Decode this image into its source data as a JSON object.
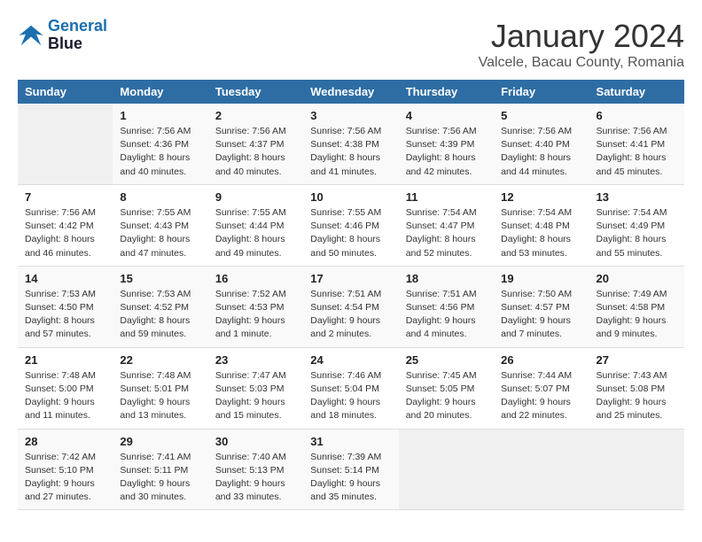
{
  "logo": {
    "line1": "General",
    "line2": "Blue"
  },
  "title": "January 2024",
  "location": "Valcele, Bacau County, Romania",
  "days_header": [
    "Sunday",
    "Monday",
    "Tuesday",
    "Wednesday",
    "Thursday",
    "Friday",
    "Saturday"
  ],
  "weeks": [
    [
      {
        "date": "",
        "sunrise": "",
        "sunset": "",
        "daylight": ""
      },
      {
        "date": "1",
        "sunrise": "Sunrise: 7:56 AM",
        "sunset": "Sunset: 4:36 PM",
        "daylight": "Daylight: 8 hours and 40 minutes."
      },
      {
        "date": "2",
        "sunrise": "Sunrise: 7:56 AM",
        "sunset": "Sunset: 4:37 PM",
        "daylight": "Daylight: 8 hours and 40 minutes."
      },
      {
        "date": "3",
        "sunrise": "Sunrise: 7:56 AM",
        "sunset": "Sunset: 4:38 PM",
        "daylight": "Daylight: 8 hours and 41 minutes."
      },
      {
        "date": "4",
        "sunrise": "Sunrise: 7:56 AM",
        "sunset": "Sunset: 4:39 PM",
        "daylight": "Daylight: 8 hours and 42 minutes."
      },
      {
        "date": "5",
        "sunrise": "Sunrise: 7:56 AM",
        "sunset": "Sunset: 4:40 PM",
        "daylight": "Daylight: 8 hours and 44 minutes."
      },
      {
        "date": "6",
        "sunrise": "Sunrise: 7:56 AM",
        "sunset": "Sunset: 4:41 PM",
        "daylight": "Daylight: 8 hours and 45 minutes."
      }
    ],
    [
      {
        "date": "7",
        "sunrise": "Sunrise: 7:56 AM",
        "sunset": "Sunset: 4:42 PM",
        "daylight": "Daylight: 8 hours and 46 minutes."
      },
      {
        "date": "8",
        "sunrise": "Sunrise: 7:55 AM",
        "sunset": "Sunset: 4:43 PM",
        "daylight": "Daylight: 8 hours and 47 minutes."
      },
      {
        "date": "9",
        "sunrise": "Sunrise: 7:55 AM",
        "sunset": "Sunset: 4:44 PM",
        "daylight": "Daylight: 8 hours and 49 minutes."
      },
      {
        "date": "10",
        "sunrise": "Sunrise: 7:55 AM",
        "sunset": "Sunset: 4:46 PM",
        "daylight": "Daylight: 8 hours and 50 minutes."
      },
      {
        "date": "11",
        "sunrise": "Sunrise: 7:54 AM",
        "sunset": "Sunset: 4:47 PM",
        "daylight": "Daylight: 8 hours and 52 minutes."
      },
      {
        "date": "12",
        "sunrise": "Sunrise: 7:54 AM",
        "sunset": "Sunset: 4:48 PM",
        "daylight": "Daylight: 8 hours and 53 minutes."
      },
      {
        "date": "13",
        "sunrise": "Sunrise: 7:54 AM",
        "sunset": "Sunset: 4:49 PM",
        "daylight": "Daylight: 8 hours and 55 minutes."
      }
    ],
    [
      {
        "date": "14",
        "sunrise": "Sunrise: 7:53 AM",
        "sunset": "Sunset: 4:50 PM",
        "daylight": "Daylight: 8 hours and 57 minutes."
      },
      {
        "date": "15",
        "sunrise": "Sunrise: 7:53 AM",
        "sunset": "Sunset: 4:52 PM",
        "daylight": "Daylight: 8 hours and 59 minutes."
      },
      {
        "date": "16",
        "sunrise": "Sunrise: 7:52 AM",
        "sunset": "Sunset: 4:53 PM",
        "daylight": "Daylight: 9 hours and 1 minute."
      },
      {
        "date": "17",
        "sunrise": "Sunrise: 7:51 AM",
        "sunset": "Sunset: 4:54 PM",
        "daylight": "Daylight: 9 hours and 2 minutes."
      },
      {
        "date": "18",
        "sunrise": "Sunrise: 7:51 AM",
        "sunset": "Sunset: 4:56 PM",
        "daylight": "Daylight: 9 hours and 4 minutes."
      },
      {
        "date": "19",
        "sunrise": "Sunrise: 7:50 AM",
        "sunset": "Sunset: 4:57 PM",
        "daylight": "Daylight: 9 hours and 7 minutes."
      },
      {
        "date": "20",
        "sunrise": "Sunrise: 7:49 AM",
        "sunset": "Sunset: 4:58 PM",
        "daylight": "Daylight: 9 hours and 9 minutes."
      }
    ],
    [
      {
        "date": "21",
        "sunrise": "Sunrise: 7:48 AM",
        "sunset": "Sunset: 5:00 PM",
        "daylight": "Daylight: 9 hours and 11 minutes."
      },
      {
        "date": "22",
        "sunrise": "Sunrise: 7:48 AM",
        "sunset": "Sunset: 5:01 PM",
        "daylight": "Daylight: 9 hours and 13 minutes."
      },
      {
        "date": "23",
        "sunrise": "Sunrise: 7:47 AM",
        "sunset": "Sunset: 5:03 PM",
        "daylight": "Daylight: 9 hours and 15 minutes."
      },
      {
        "date": "24",
        "sunrise": "Sunrise: 7:46 AM",
        "sunset": "Sunset: 5:04 PM",
        "daylight": "Daylight: 9 hours and 18 minutes."
      },
      {
        "date": "25",
        "sunrise": "Sunrise: 7:45 AM",
        "sunset": "Sunset: 5:05 PM",
        "daylight": "Daylight: 9 hours and 20 minutes."
      },
      {
        "date": "26",
        "sunrise": "Sunrise: 7:44 AM",
        "sunset": "Sunset: 5:07 PM",
        "daylight": "Daylight: 9 hours and 22 minutes."
      },
      {
        "date": "27",
        "sunrise": "Sunrise: 7:43 AM",
        "sunset": "Sunset: 5:08 PM",
        "daylight": "Daylight: 9 hours and 25 minutes."
      }
    ],
    [
      {
        "date": "28",
        "sunrise": "Sunrise: 7:42 AM",
        "sunset": "Sunset: 5:10 PM",
        "daylight": "Daylight: 9 hours and 27 minutes."
      },
      {
        "date": "29",
        "sunrise": "Sunrise: 7:41 AM",
        "sunset": "Sunset: 5:11 PM",
        "daylight": "Daylight: 9 hours and 30 minutes."
      },
      {
        "date": "30",
        "sunrise": "Sunrise: 7:40 AM",
        "sunset": "Sunset: 5:13 PM",
        "daylight": "Daylight: 9 hours and 33 minutes."
      },
      {
        "date": "31",
        "sunrise": "Sunrise: 7:39 AM",
        "sunset": "Sunset: 5:14 PM",
        "daylight": "Daylight: 9 hours and 35 minutes."
      },
      {
        "date": "",
        "sunrise": "",
        "sunset": "",
        "daylight": ""
      },
      {
        "date": "",
        "sunrise": "",
        "sunset": "",
        "daylight": ""
      },
      {
        "date": "",
        "sunrise": "",
        "sunset": "",
        "daylight": ""
      }
    ]
  ]
}
